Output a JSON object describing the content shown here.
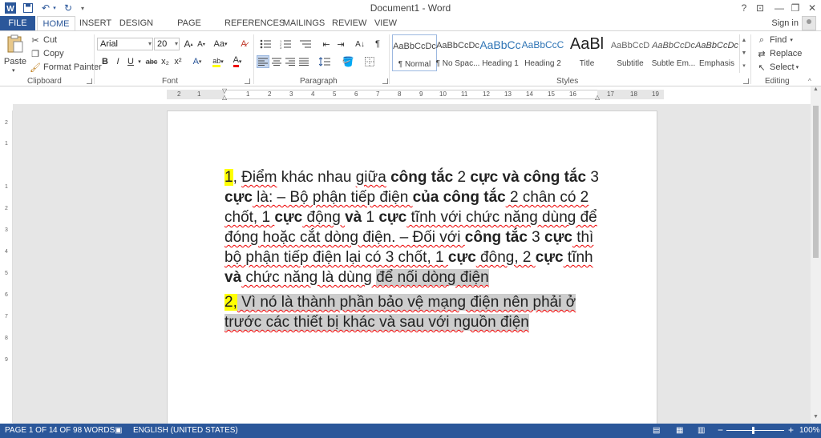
{
  "window": {
    "title": "Document1 - Word",
    "help": "?",
    "controls": [
      "⊡",
      "—",
      "❐",
      "✕"
    ]
  },
  "quick_access": {
    "save_icon": "save-icon",
    "undo_icon": "undo-icon",
    "redo_icon": "redo-icon"
  },
  "tabs": [
    "FILE",
    "HOME",
    "INSERT",
    "DESIGN",
    "PAGE LAYOUT",
    "REFERENCES",
    "MAILINGS",
    "REVIEW",
    "VIEW"
  ],
  "active_tab": "HOME",
  "account": {
    "sign_in": "Sign in"
  },
  "clipboard": {
    "paste": "Paste",
    "cut": "Cut",
    "copy": "Copy",
    "format_painter": "Format Painter",
    "group_label": "Clipboard"
  },
  "font": {
    "font_name": "Arial",
    "font_size": "20",
    "grow": "A",
    "shrink": "A",
    "case": "Aa",
    "bold": "B",
    "italic": "I",
    "underline": "U",
    "strike": "abc",
    "subscript": "x₂",
    "superscript": "x²",
    "effects": "A",
    "highlight": "ab",
    "color": "A",
    "group_label": "Font"
  },
  "paragraph": {
    "pilcrow": "¶",
    "group_label": "Paragraph"
  },
  "styles": {
    "items": [
      {
        "preview": "AaBbCcDc",
        "name": "¶ Normal"
      },
      {
        "preview": "AaBbCcDc",
        "name": "¶ No Spac..."
      },
      {
        "preview": "AaBbCc",
        "name": "Heading 1"
      },
      {
        "preview": "AaBbCcC",
        "name": "Heading 2"
      },
      {
        "preview": "AaBl",
        "name": "Title"
      },
      {
        "preview": "AaBbCcD",
        "name": "Subtitle"
      },
      {
        "preview": "AaBbCcDc",
        "name": "Subtle Em..."
      },
      {
        "preview": "AaBbCcDc",
        "name": "Emphasis"
      }
    ],
    "group_label": "Styles"
  },
  "editing": {
    "find": "Find",
    "replace": "Replace",
    "select": "Select",
    "group_label": "Editing"
  },
  "ruler": [
    "2",
    "1",
    "1",
    "2",
    "3",
    "4",
    "5",
    "6",
    "7",
    "8",
    "9",
    "10",
    "11",
    "12",
    "13",
    "14",
    "15",
    "16",
    "17",
    "18",
    "19"
  ],
  "vruler": [
    "2",
    "1",
    "1",
    "2",
    "3",
    "4",
    "5",
    "6",
    "7",
    "8",
    "9"
  ],
  "document": {
    "p1": {
      "number": "1",
      "t1": ", ",
      "w_diem": "Điểm",
      "t2": " khác nhau ",
      "w_giua": "giữa",
      "t3": " ",
      "b_congtac1": "công tắc",
      "t4": " 2 ",
      "b_cucva": "cực và công tắc",
      "t5": " 3 ",
      "b_cuc1": "cực",
      "t6": " là: – Bộ phận tiếp điện ",
      "b_cua": "của công tắc",
      "t7": " 2 chân có 2 chốt, 1 ",
      "b_cuc2": "cực",
      "t8": " động ",
      "b_va1": "và",
      "t9": " 1 ",
      "b_cuc3": "cực",
      "t10": " tĩnh với chức năng dùng để đóng hoặc cắt dòng điện. – Đối với ",
      "b_congtac3": "công tắc",
      "t11": " 3 ",
      "b_cuc4": "cực",
      "t12": " thì bộ phận tiếp điện lại có 3 chốt, 1 ",
      "b_cuc5": "cực",
      "t13": " đông, 2 ",
      "b_cuc6": "cực",
      "t14": " tĩnh ",
      "b_va2": "và",
      "t15": " chức năng là dùng ",
      "sel": "để nối dòng điện"
    },
    "p2": {
      "number": "2,",
      "text": " Vì nó là thành phần bảo vệ mạng điện nên phải ở trước các thiết bị khác và sau với nguồn điện"
    }
  },
  "status": {
    "page": "PAGE 1 OF 1",
    "words": "4 OF 98 WORDS",
    "language": "ENGLISH (UNITED STATES)",
    "zoom": "100%",
    "minus": "−",
    "plus": "+"
  },
  "colors": {
    "accent": "#2b579a",
    "highlight": "#ffff00",
    "selection": "#cdcdcd",
    "spell": "#e00000"
  }
}
